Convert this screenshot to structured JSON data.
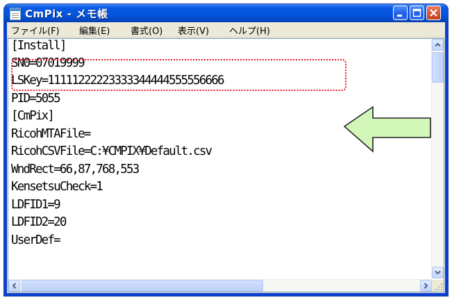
{
  "window": {
    "title": "CmPix - メモ帳"
  },
  "menu": [
    "ファイル(F)",
    "編集(E)",
    "書式(O)",
    "表示(V)",
    "ヘルプ(H)"
  ],
  "lines": [
    "[Install]",
    "SN0=07019999",
    "LSKey=11111222223333344444555556666",
    "PID=5055",
    "[CmPix]",
    "RicohMTAFile=",
    "RicohCSVFile=C:¥CMPIX¥Default.csv",
    "WndRect=66,87,768,553",
    "KensetsuCheck=1",
    "LDFID1=9",
    "LDFID2=20",
    "UserDef="
  ],
  "colors": {
    "titlebar": "#0556e0",
    "highlight": "#e8141e",
    "arrow_fill": "#d2f7b9",
    "arrow_stroke": "#222222"
  },
  "icons": [
    "notepad-icon",
    "minimize-icon",
    "maximize-icon",
    "close-icon",
    "scroll-up-icon",
    "scroll-down-icon",
    "scroll-left-icon",
    "scroll-right-icon",
    "arrow-left-icon"
  ]
}
